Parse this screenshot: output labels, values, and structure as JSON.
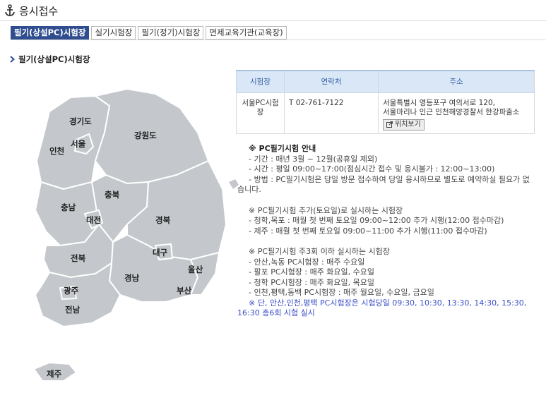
{
  "page": {
    "title": "응시접수",
    "icon": "anchor-icon"
  },
  "tabs": [
    {
      "label": "필기(상설PC)시험장",
      "active": true
    },
    {
      "label": "실기시험장",
      "active": false
    },
    {
      "label": "필기(정기)시험장",
      "active": false
    },
    {
      "label": "면제교육기관(교육장)",
      "active": false
    }
  ],
  "section": {
    "title": "필기(상설PC)시험장"
  },
  "map": {
    "regions": [
      "경기도",
      "서울",
      "인천",
      "강원도",
      "충북",
      "충남",
      "대전",
      "경북",
      "대구",
      "전북",
      "경남",
      "울산",
      "부산",
      "광주",
      "전남",
      "제주"
    ]
  },
  "table": {
    "headers": [
      "시험장",
      "연락처",
      "주소"
    ],
    "rows": [
      {
        "name": "서울PC시험장",
        "phone": "T 02-761-7122",
        "address1": "서울특별시 영등포구 여의서로 120,",
        "address2": "서울마리나 인근 인천해양경찰서 한강파출소",
        "button": "위치보기"
      }
    ]
  },
  "notes": {
    "heading": "※ PC필기시험 안내",
    "lines1": [
      "- 기간 : 매년 3월 ~ 12월(공휴일 제외)",
      "- 시간 : 평일 09:00~17:00(점심시간 접수 및 응시불가 : 12:00~13:00)",
      "- 방법 : PC필기시험은 당일 방문 접수하여 당일 응시하므로 별도로 예약하실 필요가 없습니다."
    ],
    "sub1": "※ PC필기시험 추가(토요일)로 실시하는 시험장",
    "lines2": [
      "- 청학,목포 : 매월 첫 번째 토요일 09:00~12:00 추가 시행(12:00 접수마감)",
      "- 제주 : 매월 첫 번째 토요일 09:00~11:00 추가 시행(11:00 접수마감)"
    ],
    "sub2": "※ PC필기시험 주3회 이하 실시하는 시험장",
    "lines3": [
      "- 안산,녹동 PC시험장 : 매주 수요일",
      "- 팔포 PC시험장 : 매주 화요일, 수요일",
      "- 청학 PC시험장 : 매주 화요일, 목요일",
      "- 인천,평택,동백 PC시험장 : 매주 월요일, 수요일, 금요일"
    ],
    "footnote": "※ 단, 안산,인천,평택 PC시험장은 시험당일 09:30, 10:30, 13:30, 14:30, 15:30, 16:30 총6회 시험 실시"
  },
  "colors": {
    "tab_active": "#2f4d8f",
    "table_header": "#d9e7f6",
    "footnote": "#3a4fc8",
    "map_fill": "#c4c8cc"
  }
}
